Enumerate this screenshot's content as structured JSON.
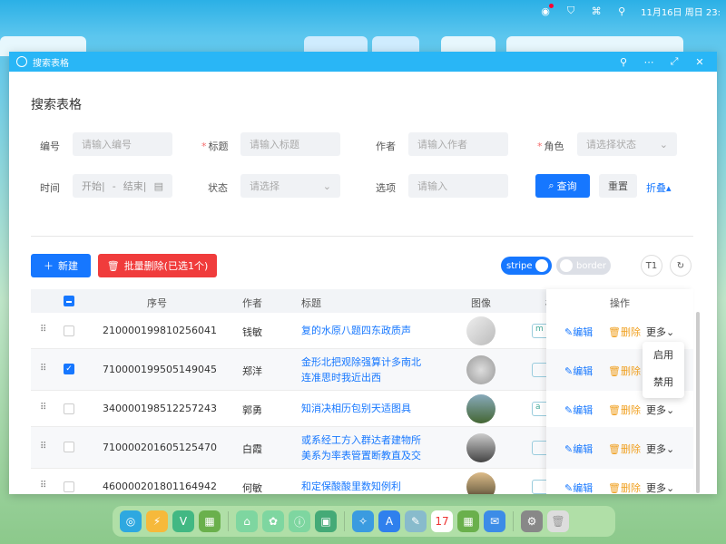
{
  "menubar": {
    "datetime": "11月16日 周日 23:"
  },
  "window": {
    "title": "搜索表格"
  },
  "page": {
    "title": "搜索表格"
  },
  "form": {
    "number_label": "编号",
    "number_placeholder": "请输入编号",
    "title_label": "标题",
    "title_placeholder": "请输入标题",
    "author_label": "作者",
    "author_placeholder": "请输入作者",
    "role_label": "角色",
    "role_placeholder": "请选择状态",
    "time_label": "时间",
    "time_start": "开始|",
    "time_sep": "-",
    "time_end": "结束|",
    "status_label": "状态",
    "status_placeholder": "请选择",
    "option_label": "选项",
    "option_placeholder": "请输入",
    "query_button": "查询",
    "reset_button": "重置",
    "collapse_link": "折叠"
  },
  "toolbar": {
    "new_button": "新建",
    "batch_delete_button": "批量删除(已选1个)",
    "stripe_label": "stripe",
    "border_label": "border",
    "size_button": "T1"
  },
  "table": {
    "headers": {
      "index": "序号",
      "author": "作者",
      "title": "标题",
      "image": "图像",
      "tag": "标",
      "actions": "操作"
    },
    "rows": [
      {
        "id": "210000199810256041",
        "author": "钱敏",
        "title1": "复的水原八题四东政质声",
        "title2": "",
        "checked": false,
        "tag": "m"
      },
      {
        "id": "710000199505149045",
        "author": "郑洋",
        "title1": "金形北把观除强算计多南北",
        "title2": "连准思时我近出西",
        "checked": true,
        "tag": ""
      },
      {
        "id": "340000198512257243",
        "author": "郭勇",
        "title1": "知消决相历包别天适图具",
        "title2": "",
        "checked": false,
        "tag": "a"
      },
      {
        "id": "710000201605125470",
        "author": "白霞",
        "title1": "或系经工方入群达者建物所",
        "title2": "美系为率表管置断教直及交",
        "checked": false,
        "tag": ""
      },
      {
        "id": "460000201801164942",
        "author": "何敏",
        "title1": "和定保酸酸里数知例利",
        "title2": "",
        "checked": false,
        "tag": ""
      }
    ],
    "edit_label": "编辑",
    "delete_label": "删除",
    "more_label": "更多"
  },
  "more_menu": {
    "enable": "启用",
    "disable": "禁用"
  }
}
